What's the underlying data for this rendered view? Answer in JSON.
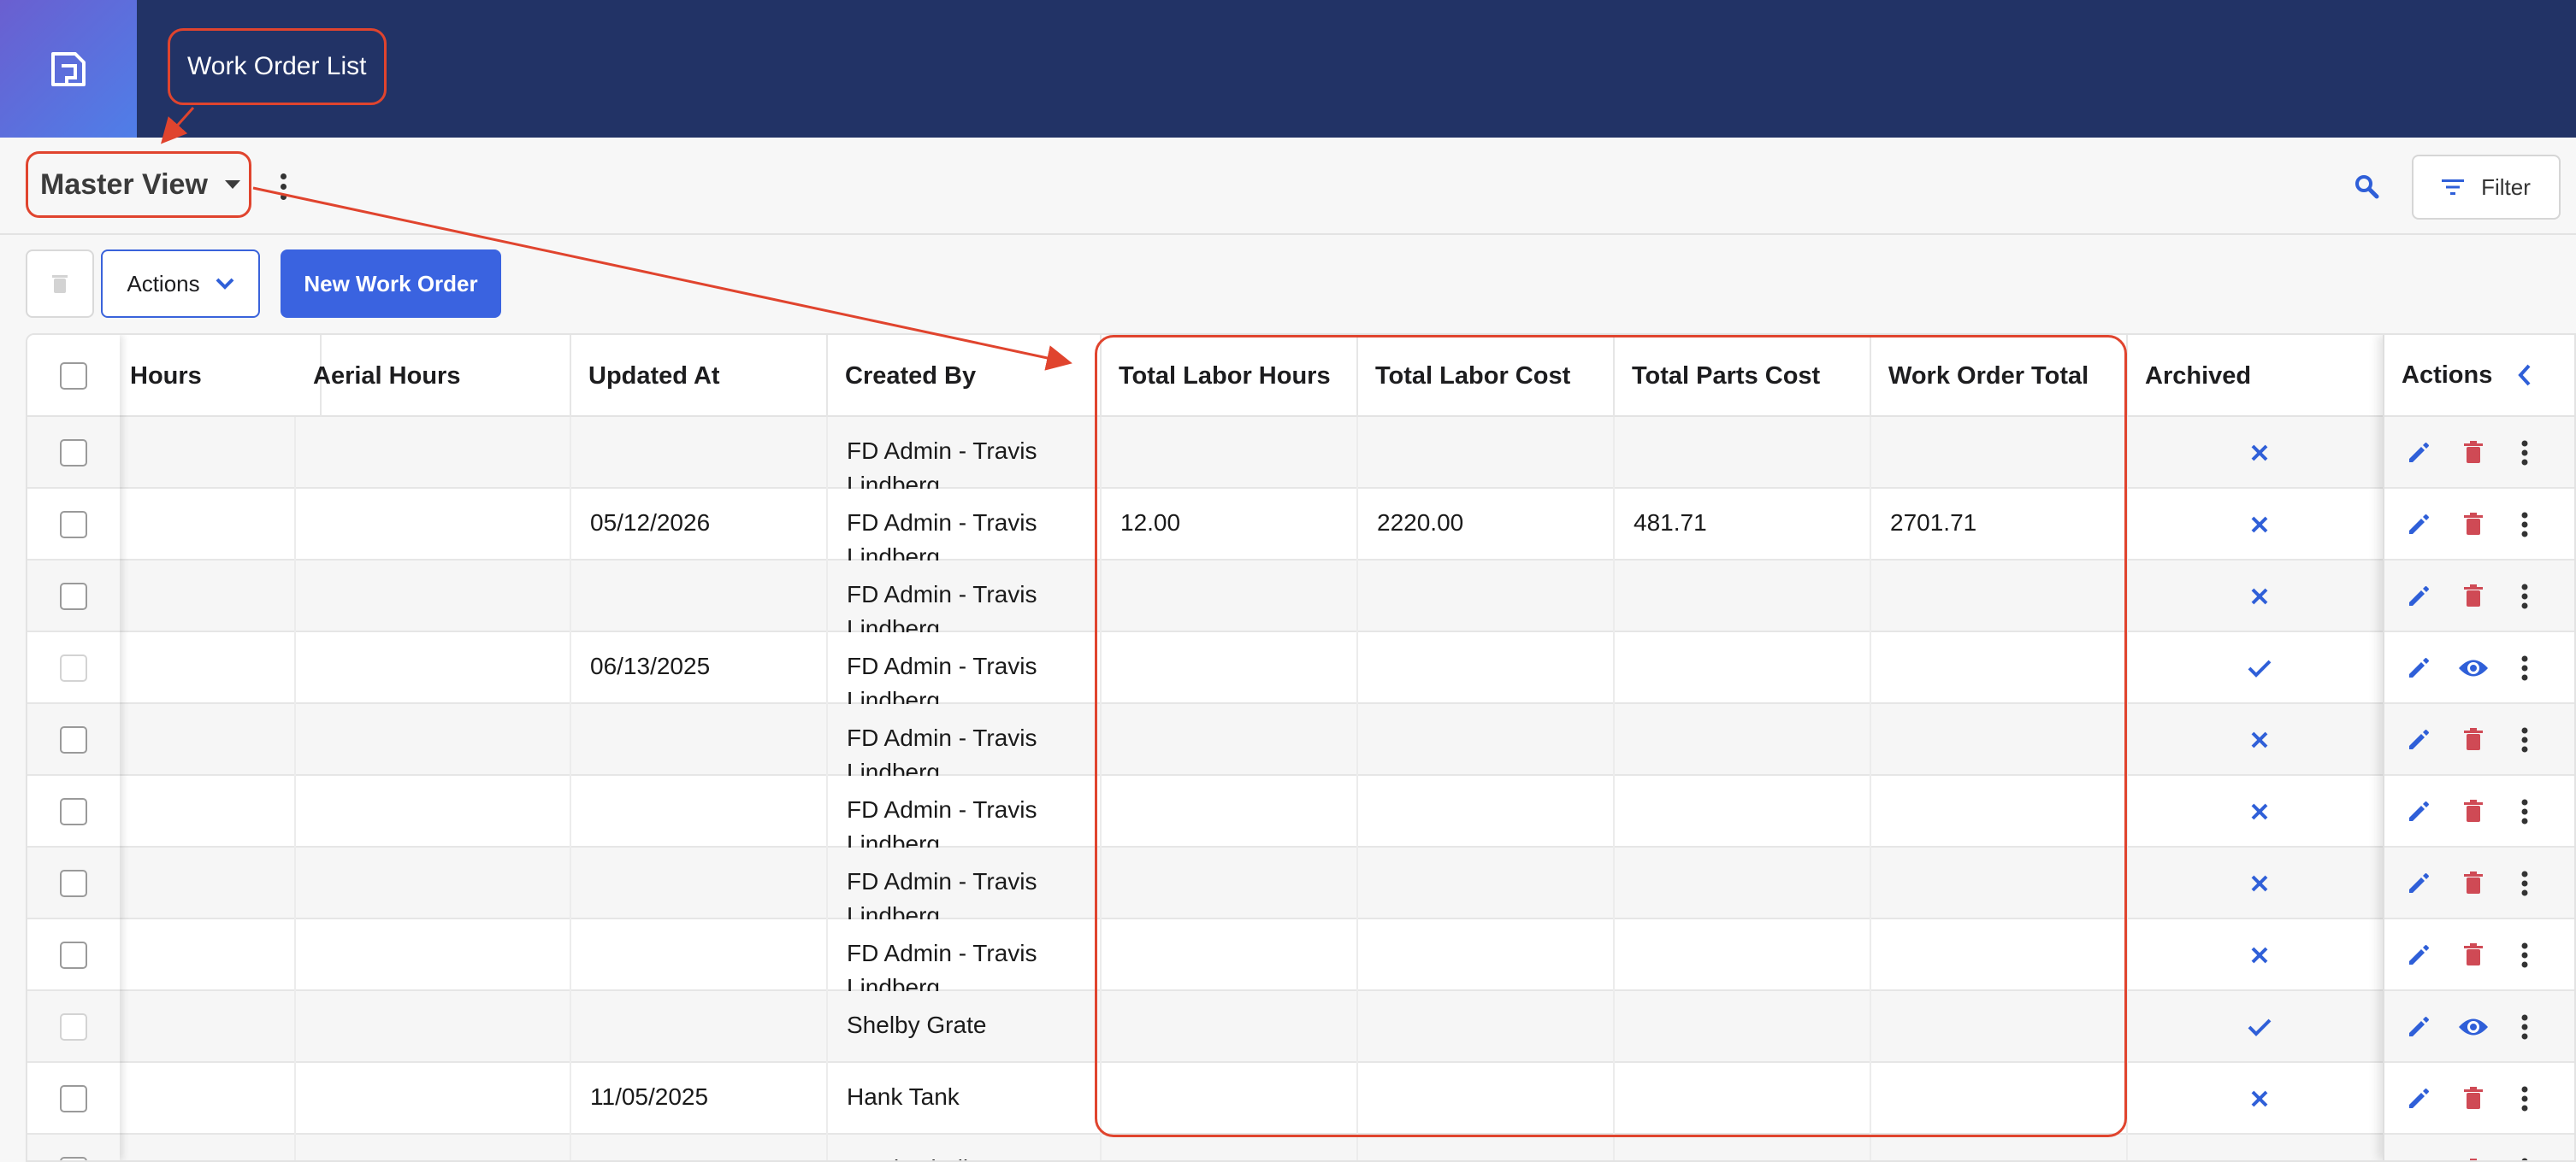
{
  "app": {
    "title": "Work Order List",
    "accent": "#3a63e0",
    "header_bg": "#223366",
    "highlight": "#e0442e"
  },
  "view": {
    "name": "Master View"
  },
  "toolbar": {
    "filter_label": "Filter",
    "actions_label": "Actions",
    "new_label": "New Work Order"
  },
  "table": {
    "columns": [
      "Hours",
      "Aerial Hours",
      "Updated At",
      "Created By",
      "Total Labor Hours",
      "Total Labor Cost",
      "Total Parts Cost",
      "Work Order Total",
      "Archived"
    ],
    "actions_header": "Actions",
    "rows": [
      {
        "updated": "",
        "created": "FD Admin - Travis Lindberg",
        "labor_hours": "",
        "labor_cost": "",
        "parts_cost": "",
        "total": "",
        "archived": false,
        "viewable": false
      },
      {
        "updated": "05/12/2026",
        "created": "FD Admin - Travis Lindberg",
        "labor_hours": "12.00",
        "labor_cost": "2220.00",
        "parts_cost": "481.71",
        "total": "2701.71",
        "archived": false,
        "viewable": false
      },
      {
        "updated": "",
        "created": "FD Admin - Travis Lindberg",
        "labor_hours": "",
        "labor_cost": "",
        "parts_cost": "",
        "total": "",
        "archived": false,
        "viewable": false
      },
      {
        "updated": "06/13/2025",
        "created": "FD Admin - Travis Lindberg",
        "labor_hours": "",
        "labor_cost": "",
        "parts_cost": "",
        "total": "",
        "archived": true,
        "viewable": true
      },
      {
        "updated": "",
        "created": "FD Admin - Travis Lindberg",
        "labor_hours": "",
        "labor_cost": "",
        "parts_cost": "",
        "total": "",
        "archived": false,
        "viewable": false
      },
      {
        "updated": "",
        "created": "FD Admin - Travis Lindberg",
        "labor_hours": "",
        "labor_cost": "",
        "parts_cost": "",
        "total": "",
        "archived": false,
        "viewable": false
      },
      {
        "updated": "",
        "created": "FD Admin - Travis Lindberg",
        "labor_hours": "",
        "labor_cost": "",
        "parts_cost": "",
        "total": "",
        "archived": false,
        "viewable": false
      },
      {
        "updated": "",
        "created": "FD Admin - Travis Lindberg",
        "labor_hours": "",
        "labor_cost": "",
        "parts_cost": "",
        "total": "",
        "archived": false,
        "viewable": false
      },
      {
        "updated": "",
        "created": "Shelby Grate",
        "labor_hours": "",
        "labor_cost": "",
        "parts_cost": "",
        "total": "",
        "archived": true,
        "viewable": true
      },
      {
        "updated": "11/05/2025",
        "created": "Hank Tank",
        "labor_hours": "",
        "labor_cost": "",
        "parts_cost": "",
        "total": "",
        "archived": false,
        "viewable": false
      },
      {
        "updated": "",
        "created": "Travis Lindberg",
        "labor_hours": "",
        "labor_cost": "",
        "parts_cost": "",
        "total": "",
        "archived": false,
        "viewable": false
      }
    ]
  },
  "icons": [
    "app-logo-icon",
    "caret-down-icon",
    "more-vert-icon",
    "search-icon",
    "filter-icon",
    "trash-icon",
    "chevron-down-icon",
    "chevron-left-icon",
    "close-icon",
    "check-icon",
    "edit-icon",
    "delete-icon",
    "view-icon"
  ]
}
